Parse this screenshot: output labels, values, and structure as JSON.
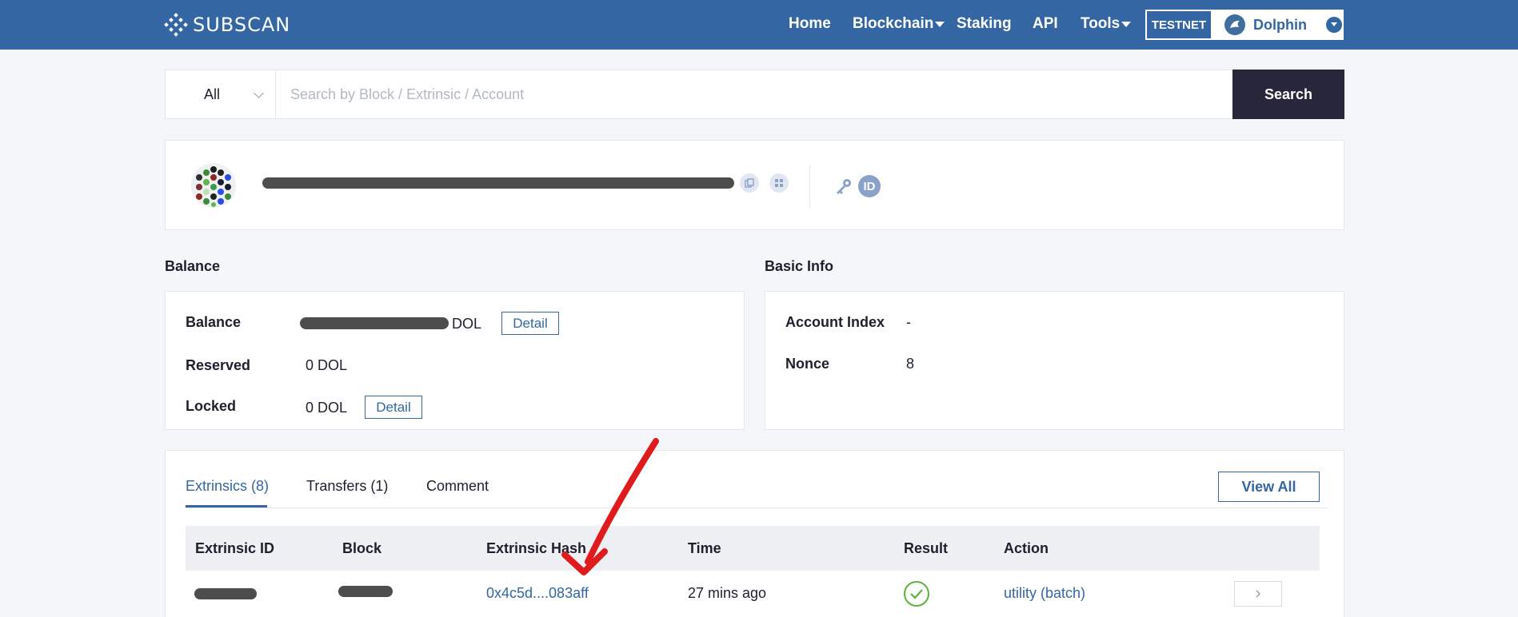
{
  "header": {
    "logo_text": "SUBSCAN",
    "nav": [
      {
        "label": "Home",
        "has_caret": false
      },
      {
        "label": "Blockchain",
        "has_caret": true
      },
      {
        "label": "Staking",
        "has_caret": false
      },
      {
        "label": "API",
        "has_caret": false
      },
      {
        "label": "Tools",
        "has_caret": true
      }
    ],
    "network_badge": "TESTNET",
    "network_name": "Dolphin",
    "accent_color": "#3366a3"
  },
  "search": {
    "scope": "All",
    "placeholder": "Search by Block / Extrinsic / Account",
    "button_label": "Search"
  },
  "account": {
    "address_redacted": true
  },
  "balance": {
    "section_title": "Balance",
    "rows": [
      {
        "label": "Balance",
        "value": "DOL",
        "value_redacted": true,
        "detail": "Detail"
      },
      {
        "label": "Reserved",
        "value": "0 DOL"
      },
      {
        "label": "Locked",
        "value": "0 DOL",
        "detail": "Detail"
      }
    ]
  },
  "basic_info": {
    "section_title": "Basic Info",
    "rows": [
      {
        "label": "Account Index",
        "value": "-"
      },
      {
        "label": "Nonce",
        "value": "8"
      }
    ]
  },
  "tabs": {
    "items": [
      {
        "label": "Extrinsics (8)",
        "active": true
      },
      {
        "label": "Transfers (1)",
        "active": false
      },
      {
        "label": "Comment",
        "active": false
      }
    ],
    "view_all": "View All"
  },
  "table": {
    "columns": [
      "Extrinsic ID",
      "Block",
      "Extrinsic Hash",
      "Time",
      "Result",
      "Action"
    ],
    "rows": [
      {
        "extrinsic_id_redacted": true,
        "block_redacted": true,
        "hash": "0x4c5d....083aff",
        "time": "27 mins ago",
        "result": "success",
        "action": "utility (batch)"
      }
    ]
  },
  "icons": {
    "copy": "copy-icon",
    "qr": "qr-code-icon",
    "key": "key-icon",
    "identity": "ID",
    "result": "check-circle-icon",
    "row_arrow": "chevron-right-icon"
  }
}
